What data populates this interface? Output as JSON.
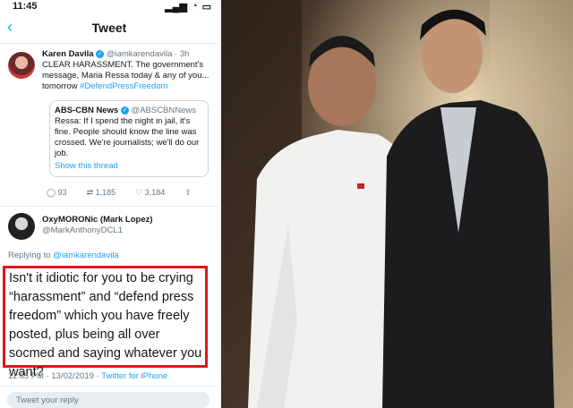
{
  "status_bar": {
    "time": "11:45"
  },
  "nav": {
    "title": "Tweet",
    "back_icon": "chevron-left-icon"
  },
  "tweet": {
    "author_name": "Karen Davila",
    "author_handle": "@iamkarendavila · 3h",
    "text": "CLEAR HARASSMENT. The government's message, Maria Ressa today & any of you... tomorrow",
    "hashtag": "#DefendPressFreedom",
    "quoted": {
      "name": "ABS-CBN News",
      "handle": "@ABSCBNNews",
      "text": "Ressa: If I spend the night in jail, it's fine. People should know the line was crossed. We're journalists; we'll do our job.",
      "show_thread": "Show this thread"
    },
    "actions": {
      "replies": "93",
      "retweets": "1,185",
      "likes": "3,184"
    }
  },
  "reply": {
    "author_name": "OxyMORONic (Mark Lopez)",
    "author_handle": "@MarkAnthonyDCL1",
    "replying_prefix": "Replying to",
    "replying_to": "@iamkarendavila",
    "text": "Isn't it idiotic for you to be crying “harassment” and “defend press freedom” which you have freely posted, plus being all over socmed and saying whatever you want?",
    "timestamp": "11:45 PM · 13/02/2019 ·",
    "client": "Twitter for iPhone"
  },
  "compose": {
    "placeholder": "Tweet your reply"
  },
  "colors": {
    "accent": "#1da1f2",
    "highlight": "#e3141c"
  }
}
